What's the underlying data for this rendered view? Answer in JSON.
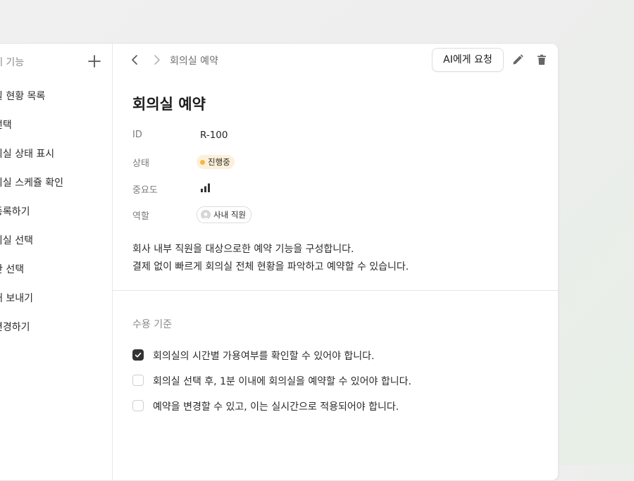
{
  "sidebar": {
    "title": "세 기능",
    "items": [
      {
        "label": "실 현황 목록"
      },
      {
        "label": "선택"
      },
      {
        "label": "의실 상태 표시"
      },
      {
        "label": "의실 스케쥴 확인"
      },
      {
        "label": "등록하기"
      },
      {
        "label": "의실 선택"
      },
      {
        "label": "간 선택"
      },
      {
        "label": "내 보내기"
      },
      {
        "label": "변경하기"
      }
    ],
    "add_icon": "plus-icon"
  },
  "topbar": {
    "breadcrumb": "회의실 예약",
    "ai_button_label": "AI에게 요청",
    "back_icon": "chevron-left-icon",
    "forward_icon": "chevron-right-icon",
    "edit_icon": "pencil-icon",
    "delete_icon": "trash-icon"
  },
  "detail": {
    "title": "회의실 예약",
    "properties": {
      "id_label": "ID",
      "id_value": "R-100",
      "status_label": "상태",
      "status_value": "진행중",
      "status_color": "#f5b642",
      "priority_label": "중요도",
      "priority_icon": "signal-bars-icon",
      "role_label": "역할",
      "role_value": "사내 직원"
    },
    "description_lines": [
      "회사 내부 직원을 대상으로한 예약 기능을 구성합니다.",
      "결제 없이 빠르게 회의실 전체 현황을 파악하고 예약할 수 있습니다."
    ]
  },
  "acceptance": {
    "title": "수용 기준",
    "items": [
      {
        "text": "회의실의 시간별 가용여부를 확인할 수 있어야 합니다.",
        "checked": true
      },
      {
        "text": "회의실 선택 후, 1분 이내에 회의실을 예약할 수 있어야 합니다.",
        "checked": false
      },
      {
        "text": "예약을 변경할 수 있고, 이는 실시간으로 적용되어야 합니다.",
        "checked": false
      }
    ]
  }
}
